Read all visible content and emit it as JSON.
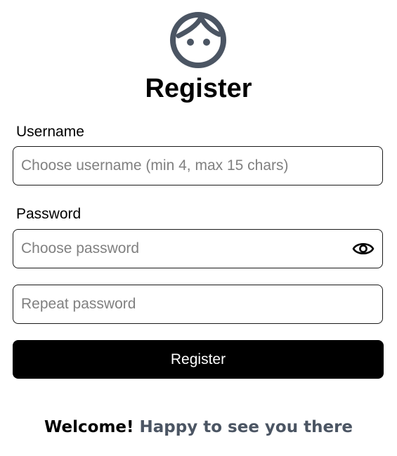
{
  "header": {
    "avatar_icon": "face-icon",
    "title": "Register"
  },
  "form": {
    "username_label": "Username",
    "username_placeholder": "Choose username (min 4, max 15 chars)",
    "password_label": "Password",
    "password_placeholder": "Choose password",
    "password_toggle_icon": "eye-icon",
    "repeat_placeholder": "Repeat password",
    "submit_label": "Register"
  },
  "footer": {
    "welcome": "Welcome!",
    "message": "Happy to see you there"
  },
  "colors": {
    "icon": "#4b5563",
    "accent": "#4b5563",
    "button_bg": "#000000",
    "button_text": "#ffffff"
  }
}
